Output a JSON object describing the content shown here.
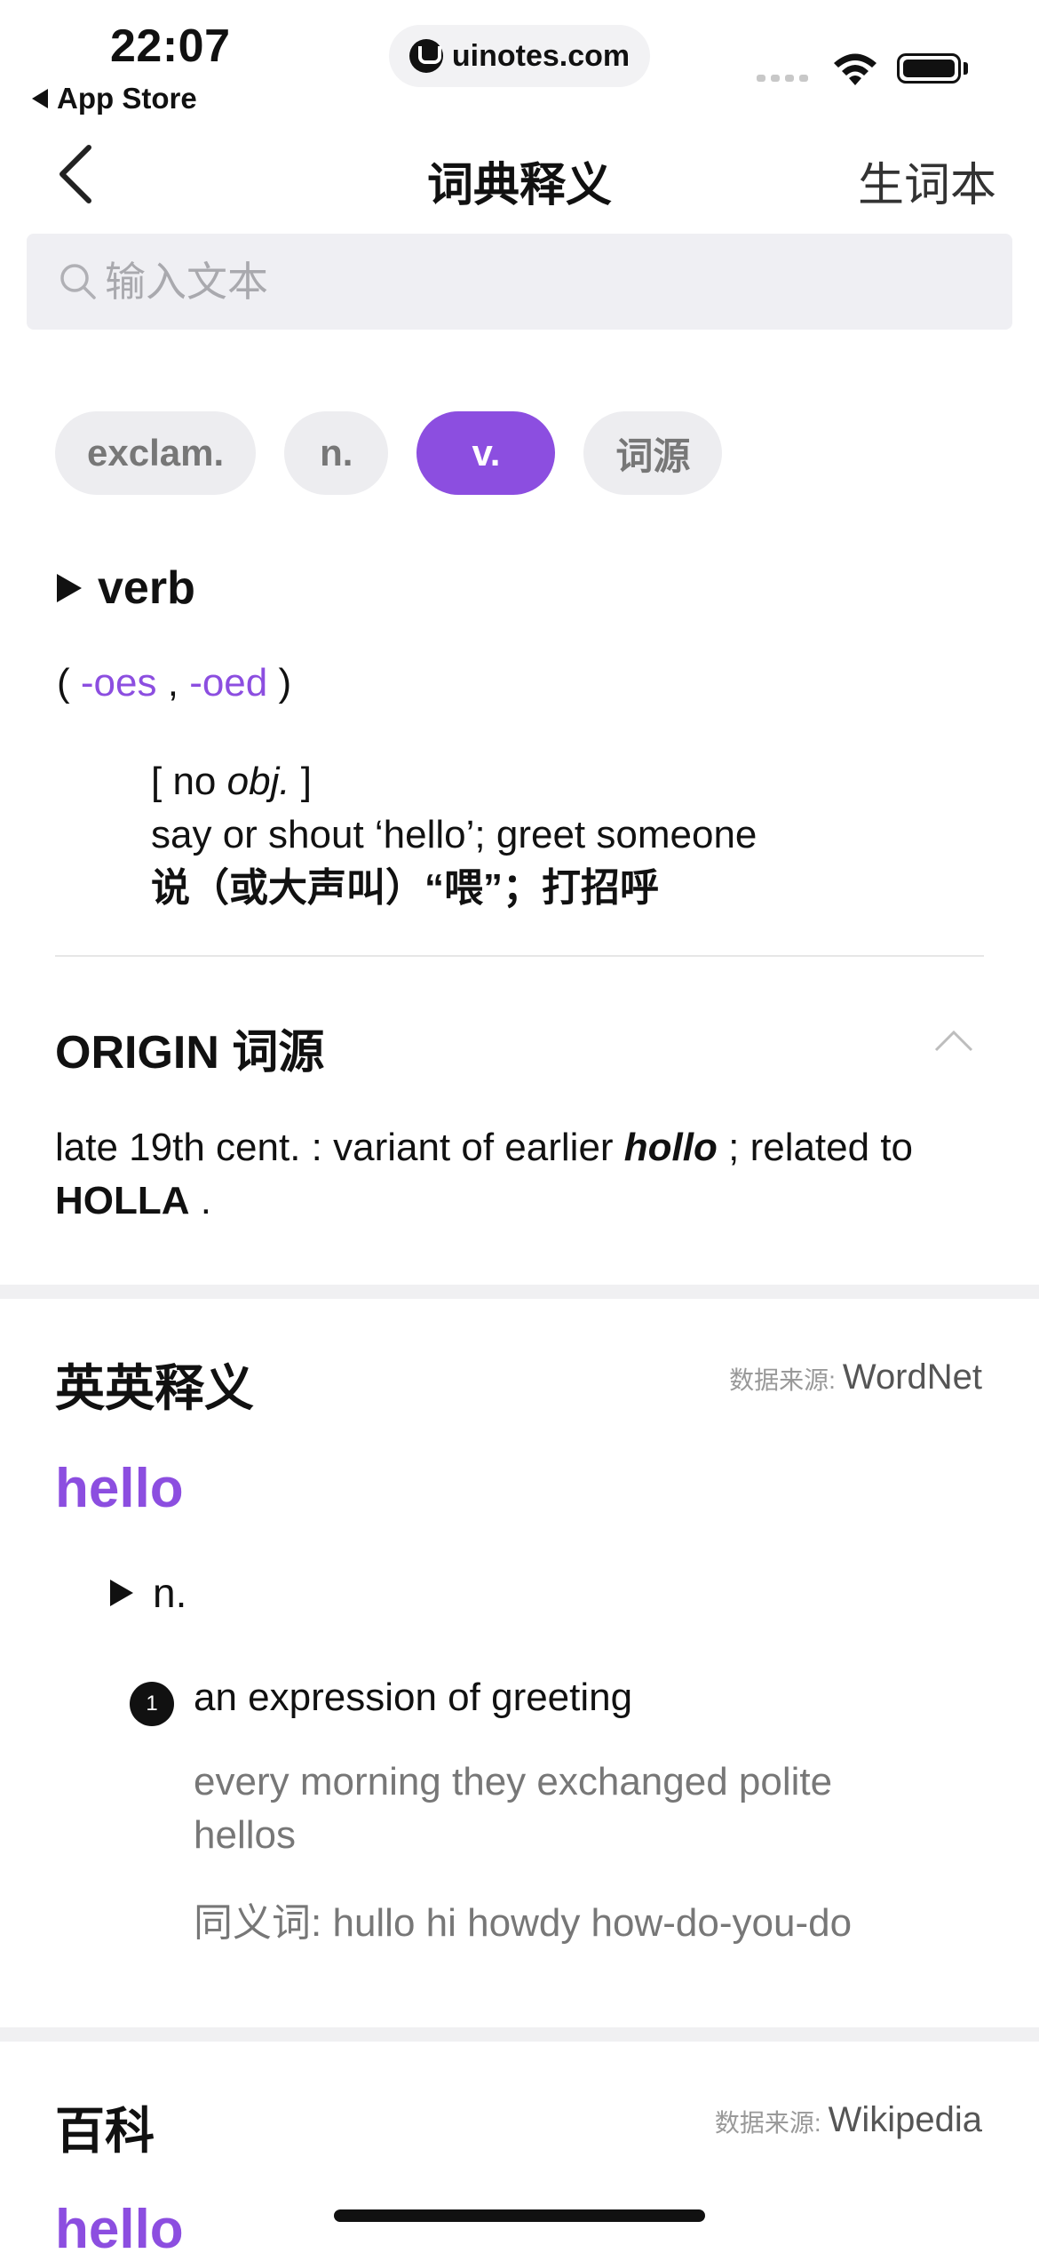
{
  "status_bar": {
    "time": "22:07",
    "back_app": "App Store",
    "url": "uinotes.com"
  },
  "nav": {
    "title": "词典释义",
    "right_label": "生词本"
  },
  "search": {
    "placeholder": "输入文本"
  },
  "tags": [
    {
      "label": "exclam.",
      "active": false
    },
    {
      "label": "n.",
      "active": false
    },
    {
      "label": "v.",
      "active": true
    },
    {
      "label": "词源",
      "active": false
    }
  ],
  "verb_section": {
    "heading": "verb",
    "inflections": {
      "open": "(",
      "form1": "-oes",
      "sep": ",",
      "form2": "-oed",
      "close": ")"
    },
    "grammar_open": "[ no ",
    "grammar_italic": "obj.",
    "grammar_close": " ]",
    "definition_en": "say or shout ‘hello’; greet someone",
    "definition_zh": "说（或大声叫）“喂”；打招呼"
  },
  "origin": {
    "heading": "ORIGIN 词源",
    "text_prefix": "late 19th cent. : variant of earlier ",
    "term_italic": "hollo",
    "text_middle": " ; related to ",
    "term_bold": "HOLLA",
    "text_suffix": " ."
  },
  "english_section": {
    "title": "英英释义",
    "source_label": "数据来源:",
    "source_value": "WordNet",
    "word": "hello",
    "pos": "n.",
    "sense_number": "1",
    "sense": "an expression of greeting",
    "example": "every morning they exchanged polite hellos",
    "synonyms_label": "同义词:",
    "synonyms": "hullo hi howdy how-do-you-do"
  },
  "encyclopedia_section": {
    "title": "百科",
    "source_label": "数据来源:",
    "source_value": "Wikipedia",
    "word": "hello"
  },
  "colors": {
    "accent": "#8c4ee0",
    "tag_bg": "#ededf0",
    "search_bg": "#efeff3"
  }
}
